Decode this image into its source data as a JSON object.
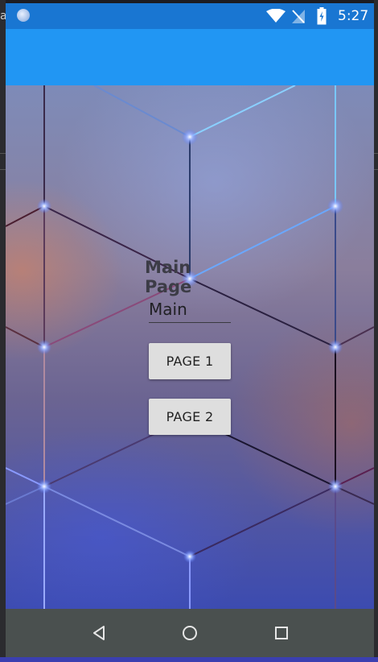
{
  "host": {
    "left_hint": "a"
  },
  "statusbar": {
    "time": "5:27",
    "icons": [
      "notification-dot-icon",
      "wifi-icon",
      "no-signal-icon",
      "battery-charging-icon"
    ]
  },
  "page": {
    "title": "Main Page",
    "entry_value": "Main",
    "buttons": [
      {
        "label": "PAGE 1"
      },
      {
        "label": "PAGE 2"
      }
    ]
  },
  "navbar": {
    "icons": [
      "back-icon",
      "home-icon",
      "recents-icon"
    ]
  },
  "colors": {
    "statusbar": "#1976d2",
    "appbar": "#2196f3",
    "navbar": "#4a504f",
    "button": "#dedede"
  }
}
